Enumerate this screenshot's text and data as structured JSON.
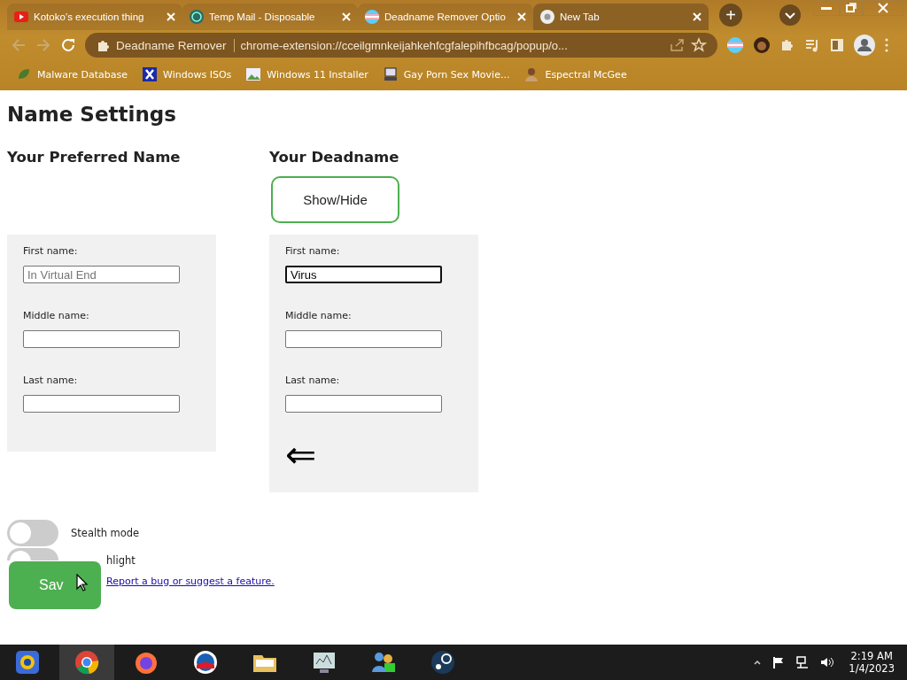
{
  "browser": {
    "tabs": [
      {
        "title": "Kotoko’s execution thing",
        "kind": "video",
        "selected": false
      },
      {
        "title": "Temp Mail - Disposable",
        "kind": "mail",
        "selected": false
      },
      {
        "title": "Deadname Remover Optio",
        "kind": "flag",
        "selected": false
      },
      {
        "title": "New Tab",
        "kind": "chrome",
        "selected": true
      }
    ],
    "new_tab": "+",
    "site_name": "Deadname Remover",
    "url": "chrome-extension://cceilgmnkeijahkehfcgfalepihfbcag/popup/o...",
    "bookmarks": [
      {
        "title": "Malware Database",
        "kind": "leaf"
      },
      {
        "title": "Windows ISOs",
        "kind": "x"
      },
      {
        "title": "Windows 11 Installer",
        "kind": "image"
      },
      {
        "title": "Gay Porn Sex Movie...",
        "kind": "computer"
      },
      {
        "title": "Espectral McGee",
        "kind": "person"
      }
    ]
  },
  "page": {
    "title": "Name Settings",
    "columns": [
      {
        "heading": "Your Preferred Name",
        "fields": [
          {
            "label": "First name:",
            "placeholder": "In Virtual End",
            "focused": false
          },
          {
            "label": "Middle name:",
            "focused": false
          },
          {
            "label": "Last name:",
            "focused": false
          }
        ]
      },
      {
        "heading": "Your Deadname",
        "button": "Show/Hide",
        "fields": [
          {
            "label": "First name:",
            "value": "Virus",
            "focused": true
          },
          {
            "label": "Middle name:",
            "focused": false
          },
          {
            "label": "Last name:",
            "focused": false
          }
        ],
        "arrow": "⇐"
      }
    ],
    "toggles": [
      {
        "label": "Stealth mode",
        "on": false
      },
      {
        "label": "hlight",
        "on": false
      }
    ],
    "save_button": "Sav",
    "link": "Report a bug or suggest a feature."
  },
  "taskbar": {
    "apps": [
      {
        "kind": "browser-alt"
      },
      {
        "kind": "chrome",
        "selected": true
      },
      {
        "kind": "firefox",
        "selected": false
      },
      {
        "kind": "globe",
        "selected": false
      },
      {
        "kind": "folder",
        "selected": false
      },
      {
        "kind": "monitor",
        "selected": false
      },
      {
        "kind": "people",
        "selected": false
      },
      {
        "kind": "steam",
        "selected": false
      }
    ],
    "time": "2:19 AM",
    "date": "1/4/2023"
  }
}
